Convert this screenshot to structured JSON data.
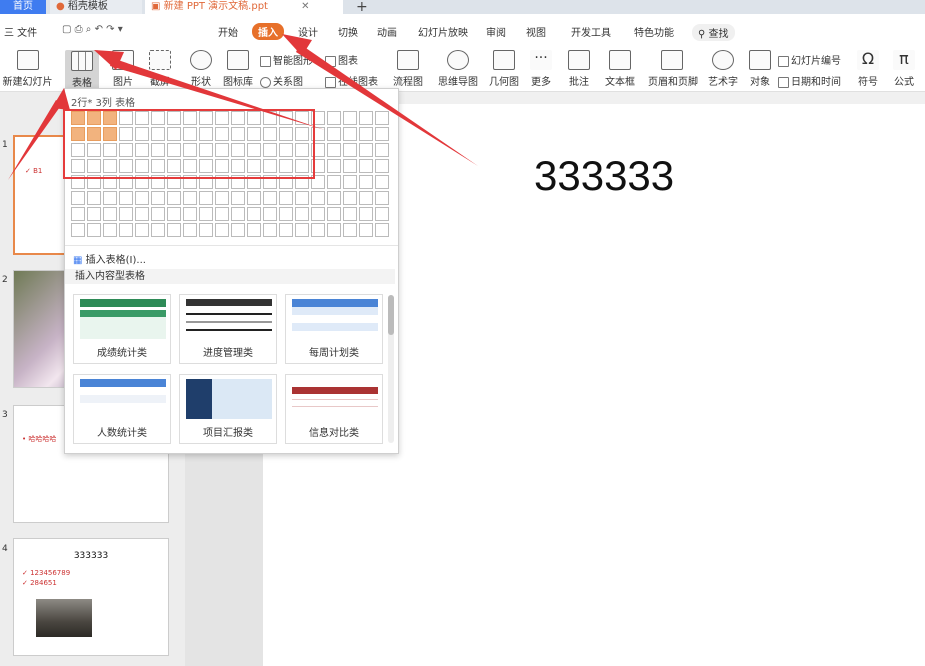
{
  "tabs": {
    "home": "首页",
    "template": "稻壳模板",
    "document": "新建 PPT 演示文稿.ppt",
    "add": "+"
  },
  "menu": {
    "file": "三 文件",
    "items": [
      "开始",
      "插入",
      "设计",
      "切换",
      "动画",
      "幻灯片放映",
      "审阅",
      "视图",
      "开发工具",
      "特色功能"
    ],
    "search": "查找"
  },
  "ribbon": {
    "new_slide": "新建幻灯片",
    "table": "表格",
    "picture": "图片",
    "screenshot": "截屏",
    "shape": "形状",
    "icon_lib": "图标库",
    "smart_art": "智能图形",
    "relation": "关系图",
    "chart": "图表",
    "online_chart": "在线图表",
    "flowchart": "流程图",
    "mindmap": "思维导图",
    "geometry": "几何图",
    "more": "更多",
    "comment": "批注",
    "textbox": "文本框",
    "header_footer": "页眉和页脚",
    "wordart": "艺术字",
    "object": "对象",
    "slide_number": "幻灯片编号",
    "datetime": "日期和时间",
    "symbol": "符号",
    "formula": "公式"
  },
  "popup": {
    "title": "2行* 3列 表格",
    "grid_rows": 8,
    "grid_cols": 20,
    "selected_rows": 2,
    "selected_cols": 3,
    "insert_table": "插入表格(I)...",
    "section_title": "插入内容型表格",
    "cards": [
      "成绩统计类",
      "进度管理类",
      "每周计划类",
      "人数统计类",
      "项目汇报类",
      "信息对比类"
    ]
  },
  "slide": {
    "main_text": "333333"
  },
  "thumbnails": {
    "t1_num": "1",
    "t1_text": "✓ B1",
    "t2_num": "2",
    "t3_num": "3",
    "t3_text": "• 哈哈哈哈",
    "t4_num": "4",
    "t4_title": "333333",
    "t4_line1": "✓ 123456789",
    "t4_line2": "✓ 284651"
  }
}
